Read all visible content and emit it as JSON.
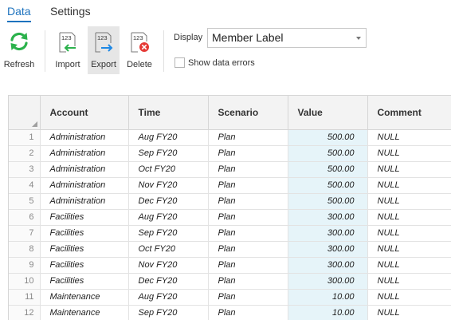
{
  "tabs": [
    {
      "label": "Data",
      "active": true
    },
    {
      "label": "Settings",
      "active": false
    }
  ],
  "toolbar": {
    "refresh": {
      "label": "Refresh",
      "icon": "refresh-icon"
    },
    "import": {
      "label": "Import",
      "icon": "import-icon",
      "glyph": "123"
    },
    "export": {
      "label": "Export",
      "icon": "export-icon",
      "glyph": "123"
    },
    "delete": {
      "label": "Delete",
      "icon": "delete-icon",
      "glyph": "123"
    },
    "display_label": "Display",
    "display_value": "Member Label",
    "show_errors_label": "Show data errors",
    "show_errors_checked": false
  },
  "colors": {
    "accent": "#1e73be",
    "refresh_green": "#2bb24c",
    "export_blue": "#1e88e5",
    "delete_red": "#e53935",
    "value_bg": "#e6f4f9"
  },
  "grid": {
    "columns": [
      "Account",
      "Time",
      "Scenario",
      "Value",
      "Comment"
    ],
    "rows": [
      {
        "n": "1",
        "account": "Administration",
        "time": "Aug FY20",
        "scenario": "Plan",
        "value": "500.00",
        "comment": "NULL"
      },
      {
        "n": "2",
        "account": "Administration",
        "time": "Sep FY20",
        "scenario": "Plan",
        "value": "500.00",
        "comment": "NULL"
      },
      {
        "n": "3",
        "account": "Administration",
        "time": "Oct FY20",
        "scenario": "Plan",
        "value": "500.00",
        "comment": "NULL"
      },
      {
        "n": "4",
        "account": "Administration",
        "time": "Nov FY20",
        "scenario": "Plan",
        "value": "500.00",
        "comment": "NULL"
      },
      {
        "n": "5",
        "account": "Administration",
        "time": "Dec FY20",
        "scenario": "Plan",
        "value": "500.00",
        "comment": "NULL"
      },
      {
        "n": "6",
        "account": "Facilities",
        "time": "Aug FY20",
        "scenario": "Plan",
        "value": "300.00",
        "comment": "NULL"
      },
      {
        "n": "7",
        "account": "Facilities",
        "time": "Sep FY20",
        "scenario": "Plan",
        "value": "300.00",
        "comment": "NULL"
      },
      {
        "n": "8",
        "account": "Facilities",
        "time": "Oct FY20",
        "scenario": "Plan",
        "value": "300.00",
        "comment": "NULL"
      },
      {
        "n": "9",
        "account": "Facilities",
        "time": "Nov FY20",
        "scenario": "Plan",
        "value": "300.00",
        "comment": "NULL"
      },
      {
        "n": "10",
        "account": "Facilities",
        "time": "Dec FY20",
        "scenario": "Plan",
        "value": "300.00",
        "comment": "NULL"
      },
      {
        "n": "11",
        "account": "Maintenance",
        "time": "Aug FY20",
        "scenario": "Plan",
        "value": "10.00",
        "comment": "NULL"
      },
      {
        "n": "12",
        "account": "Maintenance",
        "time": "Sep FY20",
        "scenario": "Plan",
        "value": "10.00",
        "comment": "NULL"
      }
    ]
  }
}
